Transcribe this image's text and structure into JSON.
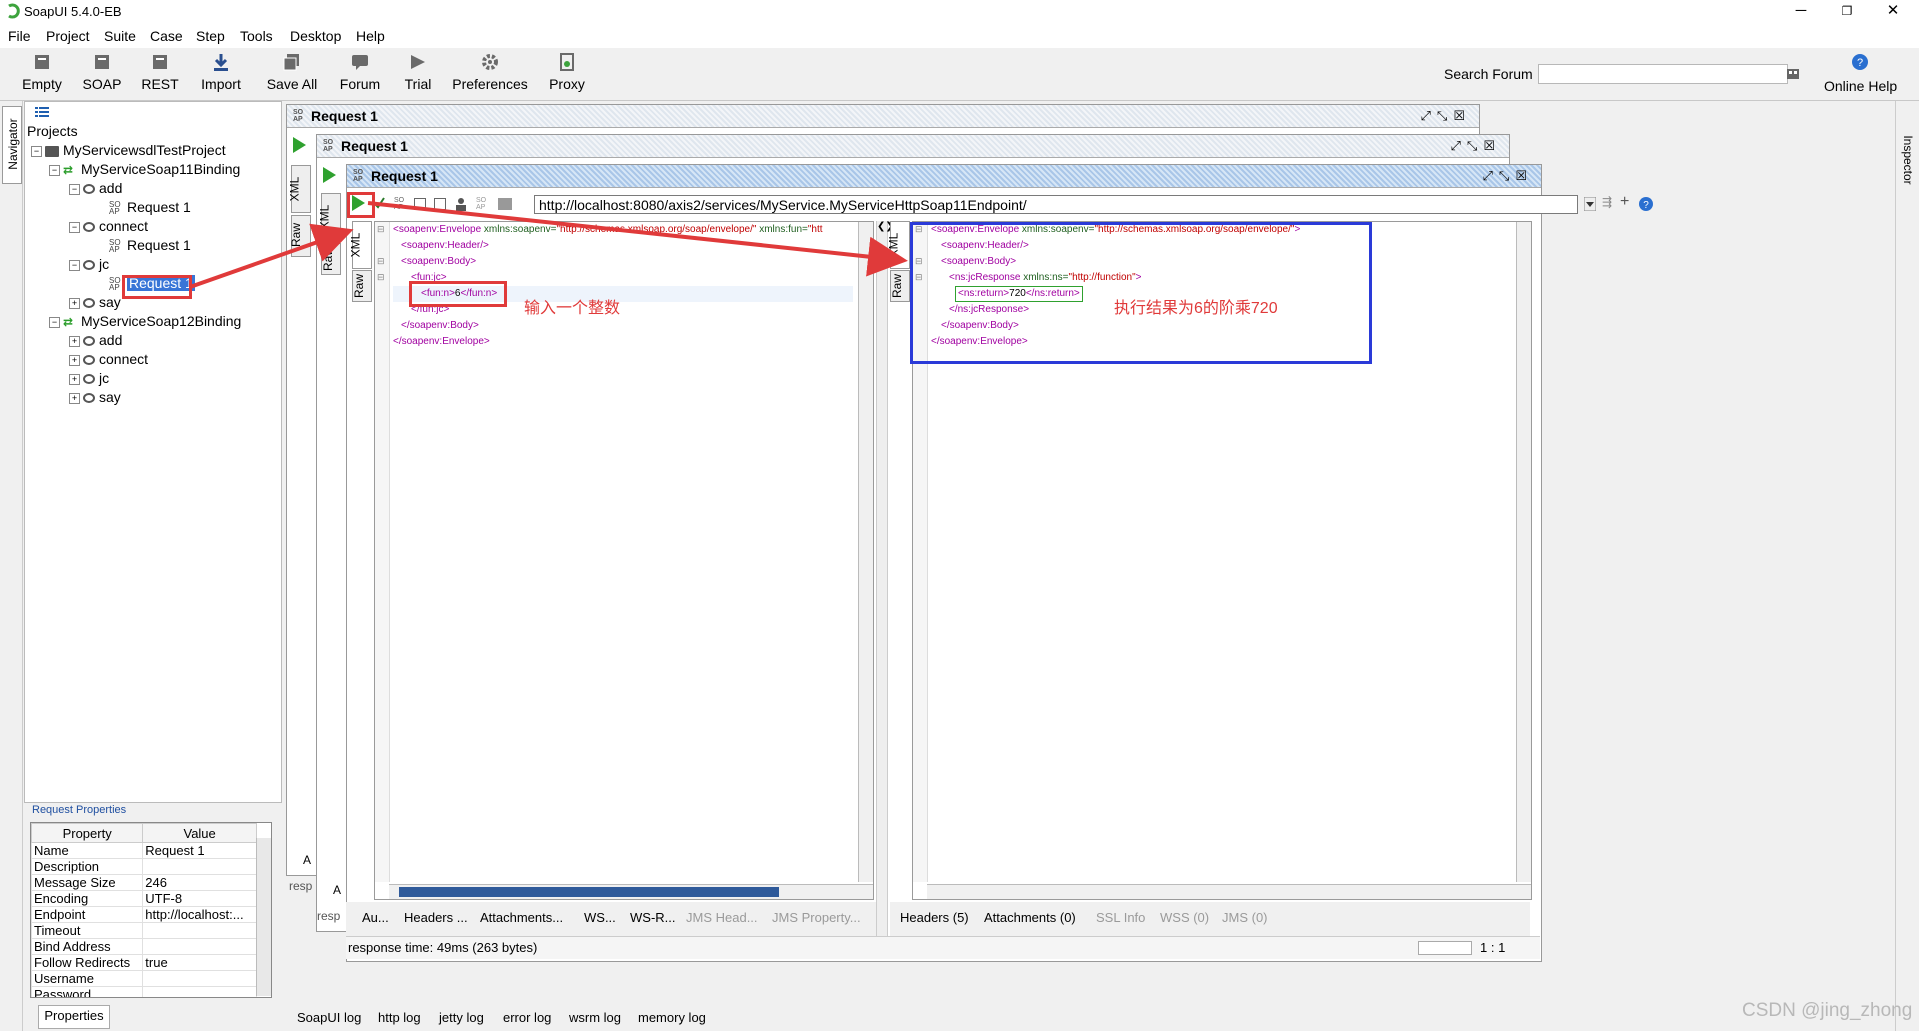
{
  "app": {
    "title": "SoapUI 5.4.0-EB"
  },
  "window_controls": {
    "minimize": "─",
    "restore": "❐",
    "close": "✕"
  },
  "menu": [
    "File",
    "Project",
    "Suite",
    "Case",
    "Step",
    "Tools",
    "Desktop",
    "Help"
  ],
  "toolbar": {
    "buttons": [
      "Empty",
      "SOAP",
      "REST",
      "Import",
      "Save All",
      "Forum",
      "Trial",
      "Preferences",
      "Proxy"
    ],
    "search_label": "Search Forum",
    "search_value": "",
    "online_help": "Online Help"
  },
  "navigator": {
    "tab_label": "Navigator",
    "root_label": "Projects",
    "project": "MyServicewsdlTestProject",
    "binding1": "MyServiceSoap11Binding",
    "binding2": "MyServiceSoap12Binding",
    "ops": [
      "add",
      "connect",
      "jc",
      "say"
    ],
    "request_label": "Request 1"
  },
  "request_properties": {
    "title": "Request Properties",
    "headers": [
      "Property",
      "Value"
    ],
    "rows": [
      [
        "Name",
        "Request 1"
      ],
      [
        "Description",
        ""
      ],
      [
        "Message Size",
        "246"
      ],
      [
        "Encoding",
        "UTF-8"
      ],
      [
        "Endpoint",
        "http://localhost:..."
      ],
      [
        "Timeout",
        ""
      ],
      [
        "Bind Address",
        ""
      ],
      [
        "Follow Redirects",
        "true"
      ],
      [
        "Username",
        ""
      ],
      [
        "Password",
        ""
      ]
    ],
    "button": "Properties"
  },
  "inspector": {
    "label": "Inspector"
  },
  "editor": {
    "window_title": "Request 1",
    "soap_badge": "SO AP",
    "tab_xml": "XML",
    "tab_raw": "Raw",
    "endpoint_url": "http://localhost:8080/axis2/services/MyService.MyServiceHttpSoap11Endpoint/",
    "request_xml": [
      {
        "tag": "<soapenv:Envelope",
        "attr": " xmlns:soapenv=",
        "val": "\"http://schemas.xmlsoap.org/soap/envelope/\"",
        "attr2": " xmlns:fun=",
        "val2": "\"htt"
      },
      {
        "tag": "<soapenv:Header/>"
      },
      {
        "tag": "<soapenv:Body>"
      },
      {
        "tag": "<fun:jc>"
      },
      {
        "tag": "<fun:n>",
        "text": "6",
        "close": "</fun:n>"
      },
      {
        "tag": "</fun:jc>"
      },
      {
        "tag": "</soapenv:Body>"
      },
      {
        "tag": "</soapenv:Envelope>"
      }
    ],
    "response_xml": [
      {
        "tag": "<soapenv:Envelope",
        "attr": " xmlns:soapenv=",
        "val": "\"http://schemas.xmlsoap.org/soap/envelope/\"",
        "close": ">"
      },
      {
        "tag": "<soapenv:Header/>"
      },
      {
        "tag": "<soapenv:Body>"
      },
      {
        "tag": "<ns:jcResponse",
        "attr": " xmlns:ns=",
        "val": "\"http://function\"",
        "close": ">"
      },
      {
        "tag": "<ns:return>",
        "text": "720",
        "close": "</ns:return>"
      },
      {
        "tag": "</ns:jcResponse>"
      },
      {
        "tag": "</soapenv:Body>"
      },
      {
        "tag": "</soapenv:Envelope>"
      }
    ],
    "request_tabs": [
      "Au...",
      "Headers ...",
      "Attachments...",
      "WS...",
      "WS-R...",
      "JMS Head...",
      "JMS Property..."
    ],
    "response_tabs": [
      "Headers (5)",
      "Attachments (0)",
      "SSL Info",
      "WSS (0)",
      "JMS (0)"
    ],
    "status": "response time: 49ms (263 bytes)",
    "position": "1 : 1",
    "side_labels": [
      "A",
      "A",
      "resp",
      "resp"
    ]
  },
  "annotations": {
    "input_note": "输入一个整数",
    "result_note": "执行结果为6的阶乘720"
  },
  "logs": [
    "SoapUI log",
    "http log",
    "jetty log",
    "error log",
    "wsrm log",
    "memory log"
  ],
  "watermark": "CSDN @jing_zhong",
  "colors": {
    "annotation_red": "#e03a3a",
    "annotation_blue": "#2a3ad8",
    "run_green": "#2fa12f"
  }
}
